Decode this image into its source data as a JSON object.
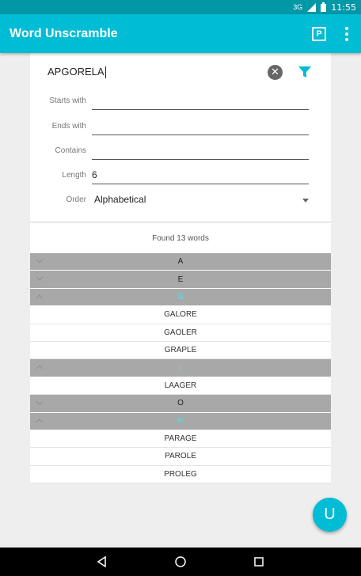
{
  "status": {
    "signal": "3G",
    "time": "11:55"
  },
  "appbar": {
    "title": "Word Unscramble",
    "p_icon_label": "P",
    "menu_icon": "more-vert-icon"
  },
  "search": {
    "value": "APGORELA",
    "clear_icon": "clear-icon",
    "filter_icon": "filter-icon"
  },
  "filters": {
    "starts_with": {
      "label": "Starts with",
      "value": ""
    },
    "ends_with": {
      "label": "Ends with",
      "value": ""
    },
    "contains": {
      "label": "Contains",
      "value": ""
    },
    "length": {
      "label": "Length",
      "value": "6"
    },
    "order": {
      "label": "Order",
      "value": "Alphabetical"
    }
  },
  "results": {
    "summary": "Found 13 words",
    "groups": [
      {
        "letter": "A",
        "expanded": false,
        "words": []
      },
      {
        "letter": "E",
        "expanded": false,
        "words": []
      },
      {
        "letter": "G",
        "expanded": true,
        "words": [
          "GALORE",
          "GAOLER",
          "GRAPLE"
        ]
      },
      {
        "letter": "L",
        "expanded": true,
        "words": [
          "LAAGER"
        ]
      },
      {
        "letter": "O",
        "expanded": false,
        "words": []
      },
      {
        "letter": "P",
        "expanded": true,
        "words": [
          "PARAGE",
          "PAROLE",
          "PROLEG"
        ]
      }
    ]
  },
  "fab": {
    "label": "U"
  },
  "colors": {
    "primary": "#00bcd4",
    "primary_dark": "#0097a7",
    "group_header": "#a8a8a8",
    "group_open_text": "#4ee0ef"
  }
}
